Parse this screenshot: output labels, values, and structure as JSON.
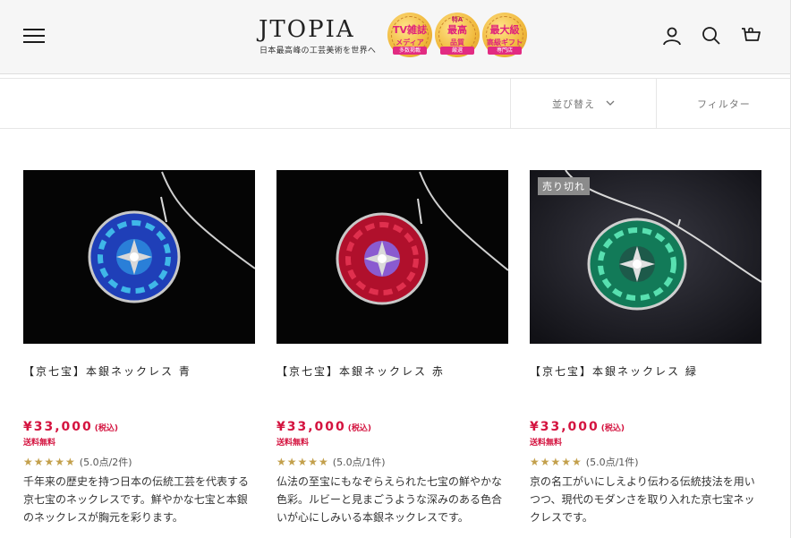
{
  "header": {
    "logo_text": "JTOPIA",
    "tagline": "日本最高峰の工芸美術を世界へ",
    "badges": [
      {
        "top": "",
        "mid": "TV雑誌",
        "bot": "メディア",
        "strip": "多数掲載"
      },
      {
        "top": "特A",
        "mid": "最高",
        "bot": "品質",
        "strip": "厳選"
      },
      {
        "top": "",
        "mid": "最大級",
        "bot": "高級ギフト",
        "strip": "専門店"
      }
    ],
    "icons": [
      "menu-icon",
      "account-icon",
      "search-icon",
      "cart-icon"
    ]
  },
  "toolbar": {
    "sort_label": "並び替え",
    "filter_label": "フィルター"
  },
  "products": [
    {
      "title": "【京七宝】本銀ネックレス 青",
      "price": "¥33,000",
      "tax": "(税込)",
      "shipping": "送料無料",
      "stars": "★★★★★",
      "rating": "(5.0点/2件)",
      "description": "千年来の歴史を持つ日本の伝統工芸を代表する京七宝のネックレスです。鮮やかな七宝と本銀のネックレスが胸元を彩ります。",
      "sold_out": "",
      "colors": {
        "enamel": "#1f3fb8",
        "accent": "#3fb7e8",
        "bg": "#050505"
      }
    },
    {
      "title": "【京七宝】本銀ネックレス 赤",
      "price": "¥33,000",
      "tax": "(税込)",
      "shipping": "送料無料",
      "stars": "★★★★★",
      "rating": "(5.0点/1件)",
      "description": "仏法の至宝にもなぞらえられた七宝の鮮やかな色彩。ルビーと見まごうような深みのある色合いが心にしみいる本銀ネックレスです。",
      "sold_out": "",
      "colors": {
        "enamel": "#b0102c",
        "accent": "#8a5bd0",
        "bg": "#050505"
      }
    },
    {
      "title": "【京七宝】本銀ネックレス 緑",
      "price": "¥33,000",
      "tax": "(税込)",
      "shipping": "送料無料",
      "stars": "★★★★★",
      "rating": "(5.0点/1件)",
      "description": "京の名工がいにしえより伝わる伝統技法を用いつつ、現代のモダンさを取り入れた京七宝ネックレスです。",
      "sold_out": "売り切れ",
      "colors": {
        "enamel": "#127a58",
        "accent": "#58e0b0",
        "bg": "#1a1a22"
      }
    }
  ]
}
